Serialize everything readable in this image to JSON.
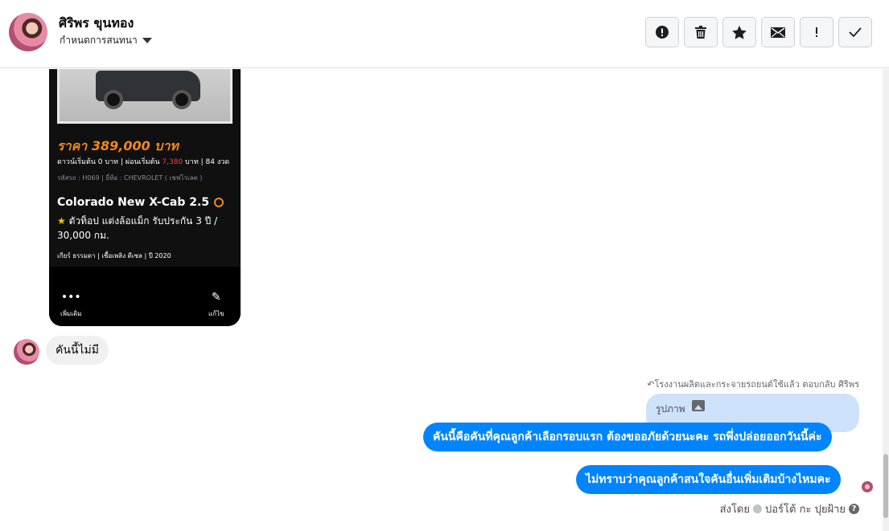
{
  "header": {
    "contact_name": "ศิริพร ขุนทอง",
    "conversation_settings": "กำหนดการสนทนา",
    "toolbar": [
      {
        "icon": "alert-circle-icon",
        "glyph": "!"
      },
      {
        "icon": "trash-icon",
        "glyph": "🗑"
      },
      {
        "icon": "star-icon",
        "glyph": "★"
      },
      {
        "icon": "envelope-icon",
        "glyph": "✉"
      },
      {
        "icon": "exclamation-icon",
        "glyph": "!"
      },
      {
        "icon": "check-icon",
        "glyph": "✓"
      }
    ]
  },
  "attachment": {
    "price": "ราคา 389,000 บาท",
    "down_prefix": "ดาวน์เริ่มต้น 0 บาท | ผ่อนเริ่มต้น",
    "down_red": "7,380",
    "down_suffix": "บาท | 84 งวด",
    "code": "รหัสรถ : H069 | ยี่ห้อ : CHEVROLET ( เชฟโรเลต )",
    "model": "Colorado New X-Cab 2.5",
    "desc": "ตัวท็อป แต่งล้อแม็ก รับประกัน 3 ปี / 30,000 กม.",
    "specs": "เกียร์ ธรรมดา  |  เชื้อเพลิง ดีเซล  |  ปี 2020",
    "more_label": "เพิ่มเติม",
    "edit_label": "แก้ไข"
  },
  "messages": {
    "incoming": "คันนี้ไม่มี",
    "reply_meta": "โรงงานผลิตและกระจายรถยนต์ใช้แล้ว ตอบกลับ ศิริพร",
    "reply_quote": "รูปภาพ",
    "outgoing": [
      "คันนี้คือคันที่คุณลูกค้าเลือกรอบแรก ต้องขออภัยด้วยนะคะ รถพึ่งปล่อยออกวันนี้ค่ะ",
      "ไม่ทราบว่าคุณลูกค้าสนใจคันอื่นเพิ่มเติมบ้างไหมคะ"
    ],
    "sent_by_prefix": "ส่งโดย",
    "sent_by_name": "ปอร์โต้ กะ ปุยฝ้าย"
  }
}
